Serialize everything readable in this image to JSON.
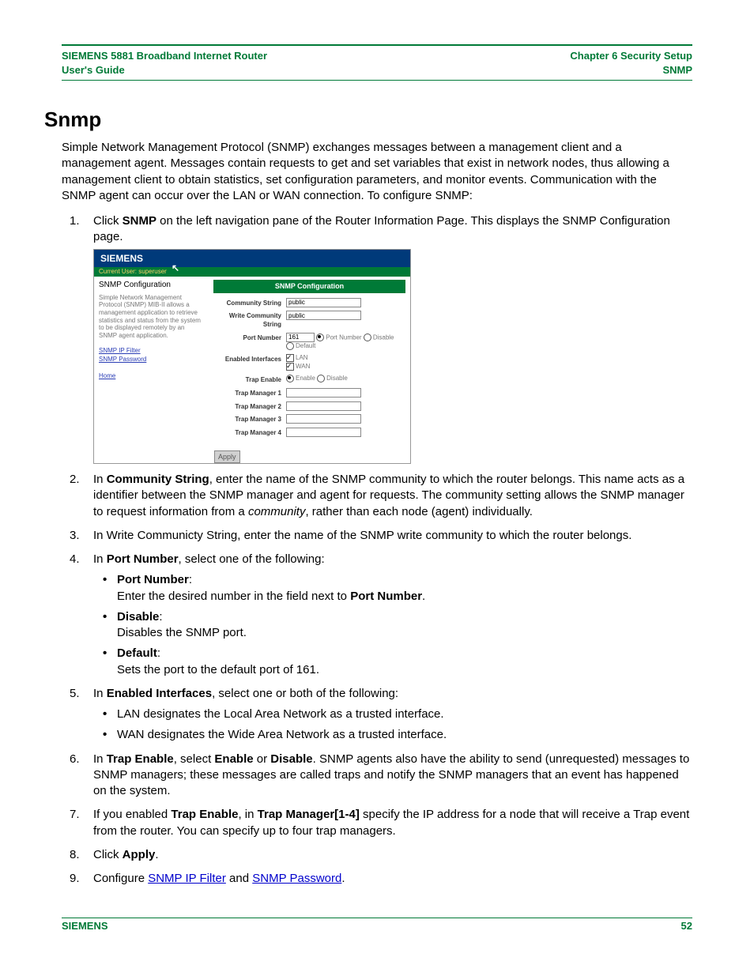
{
  "header": {
    "left_line1": "SIEMENS 5881 Broadband Internet Router",
    "left_line2": "User's Guide",
    "right_line1": "Chapter 6  Security Setup",
    "right_line2": "SNMP"
  },
  "section_title": "Snmp",
  "intro": "Simple Network Management Protocol (SNMP) exchanges messages between a management client and a management agent. Messages contain requests to get and set variables that exist in network nodes, thus allowing a management client to obtain statistics, set configuration parameters, and monitor events. Communication with the SNMP agent can occur over the LAN or WAN connection. To configure SNMP:",
  "steps": {
    "s1_a": "Click ",
    "s1_b": "SNMP",
    "s1_c": " on the left navigation pane of the Router Information Page. This displays the SNMP Configuration page.",
    "s2_a": "In ",
    "s2_b": "Community String",
    "s2_c": ", enter the name of the SNMP community to which the router belongs. This name acts as a identifier between the SNMP manager and agent for requests. The community setting allows the SNMP manager to request information from a ",
    "s2_d": "community",
    "s2_e": ", rather than each node (agent) individually.",
    "s3": "In Write Communicty String, enter the name of the SNMP write community to which the router belongs.",
    "s4_a": "In ",
    "s4_b": "Port Number",
    "s4_c": ", select one of the following:",
    "s4_items": [
      {
        "head": "Port Number",
        "tail": ":",
        "desc_a": "Enter the desired number in the field next to ",
        "desc_b": "Port Number",
        "desc_c": "."
      },
      {
        "head": "Disable",
        "tail": ":",
        "desc_a": "Disables the SNMP port.",
        "desc_b": "",
        "desc_c": ""
      },
      {
        "head": "Default",
        "tail": ":",
        "desc_a": "Sets the port to the default port of 161.",
        "desc_b": "",
        "desc_c": ""
      }
    ],
    "s5_a": "In ",
    "s5_b": "Enabled Interfaces",
    "s5_c": ", select one or both of the following:",
    "s5_items": [
      "LAN designates the Local Area Network as a trusted interface.",
      "WAN designates the Wide Area Network as a trusted interface."
    ],
    "s6_a": "In ",
    "s6_b": "Trap Enable",
    "s6_c": ", select ",
    "s6_d": "Enable",
    "s6_e": " or ",
    "s6_f": "Disable",
    "s6_g": ". SNMP agents also have the ability to send (unrequested) messages to SNMP managers; these messages are called traps and notify the SNMP managers that an event has happened on the system.",
    "s7_a": "If you enabled ",
    "s7_b": "Trap Enable",
    "s7_c": ", in ",
    "s7_d": "Trap Manager[1-4]",
    "s7_e": " specify the IP address for a node that will receive a Trap event from the router. You can specify up to four trap managers.",
    "s8_a": "Click ",
    "s8_b": "Apply",
    "s8_c": ".",
    "s9_a": "Configure ",
    "s9_link1": "SNMP IP Filter",
    "s9_mid": " and ",
    "s9_link2": "SNMP Password",
    "s9_end": "."
  },
  "shot": {
    "brand": "SIEMENS",
    "user_row": "Current User: superuser",
    "side_heading": "SNMP Configuration",
    "side_desc": "Simple Network Management Protocol (SNMP) MIB-II allows a management application to retrieve statistics and status from the system to be displayed remotely by an SNMP agent application.",
    "side_link1": "SNMP IP Filter",
    "side_link2": "SNMP Password",
    "side_link3": "Home",
    "conf_title": "SNMP Configuration",
    "labels": {
      "community": "Community String",
      "write_community": "Write Community String",
      "port": "Port Number",
      "enabled_if": "Enabled Interfaces",
      "trap_enable": "Trap Enable",
      "tm1": "Trap Manager 1",
      "tm2": "Trap Manager 2",
      "tm3": "Trap Manager 3",
      "tm4": "Trap Manager 4"
    },
    "values": {
      "community": "public",
      "write_community": "public",
      "port": "161",
      "port_radio_portnum": "Port Number",
      "port_radio_disable": "Disable",
      "port_radio_default": "Default",
      "if_lan": "LAN",
      "if_wan": "WAN",
      "te_enable": "Enable",
      "te_disable": "Disable"
    },
    "apply": "Apply"
  },
  "footer": {
    "left": "SIEMENS",
    "right": "52"
  }
}
